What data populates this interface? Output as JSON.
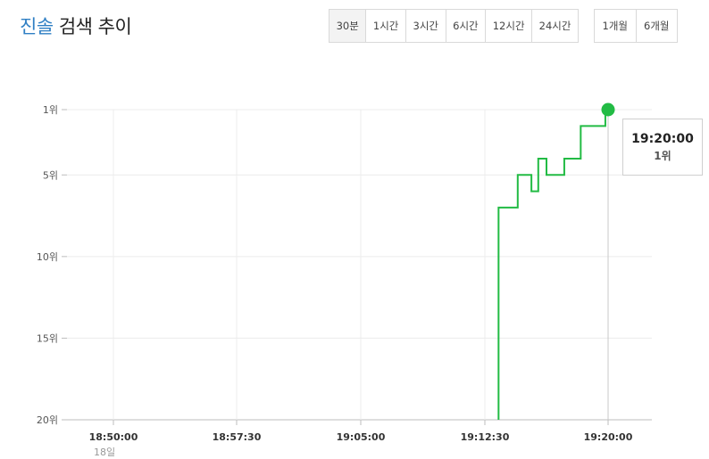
{
  "header": {
    "keyword": "진솔",
    "title_rest": "검색 추이"
  },
  "periods_short": [
    {
      "label": "30분",
      "active": true
    },
    {
      "label": "1시간",
      "active": false
    },
    {
      "label": "3시간",
      "active": false
    },
    {
      "label": "6시간",
      "active": false
    },
    {
      "label": "12시간",
      "active": false
    },
    {
      "label": "24시간",
      "active": false
    }
  ],
  "periods_long": [
    {
      "label": "1개월",
      "active": false
    },
    {
      "label": "6개월",
      "active": false
    }
  ],
  "tooltip": {
    "time": "19:20:00",
    "rank": "1위"
  },
  "chart_data": {
    "type": "line",
    "step": true,
    "x_tick_labels": [
      "18:50:00",
      "18:57:30",
      "19:05:00",
      "19:12:30",
      "19:20:00"
    ],
    "x_tick_seconds": [
      0,
      450,
      900,
      1350,
      1800
    ],
    "x_sublabel": "18일",
    "y_ticks": [
      1,
      5,
      10,
      15,
      20
    ],
    "y_tick_labels": [
      "1위",
      "5위",
      "10위",
      "15위",
      "20위"
    ],
    "y_range": [
      1,
      20
    ],
    "y_inverted": true,
    "line_color": "#22bb44",
    "grid": true,
    "series": [
      {
        "times": [
          "19:13:20",
          "19:13:20",
          "19:13:30",
          "19:14:30",
          "19:15:20",
          "19:15:45",
          "19:16:15",
          "19:17:20",
          "19:18:20",
          "19:19:50",
          "19:20:00"
        ],
        "values": [
          20,
          7,
          7,
          5,
          6,
          4,
          5,
          4,
          2,
          1,
          1
        ]
      }
    ],
    "highlight": {
      "time": "19:20:00",
      "value": 1
    }
  }
}
